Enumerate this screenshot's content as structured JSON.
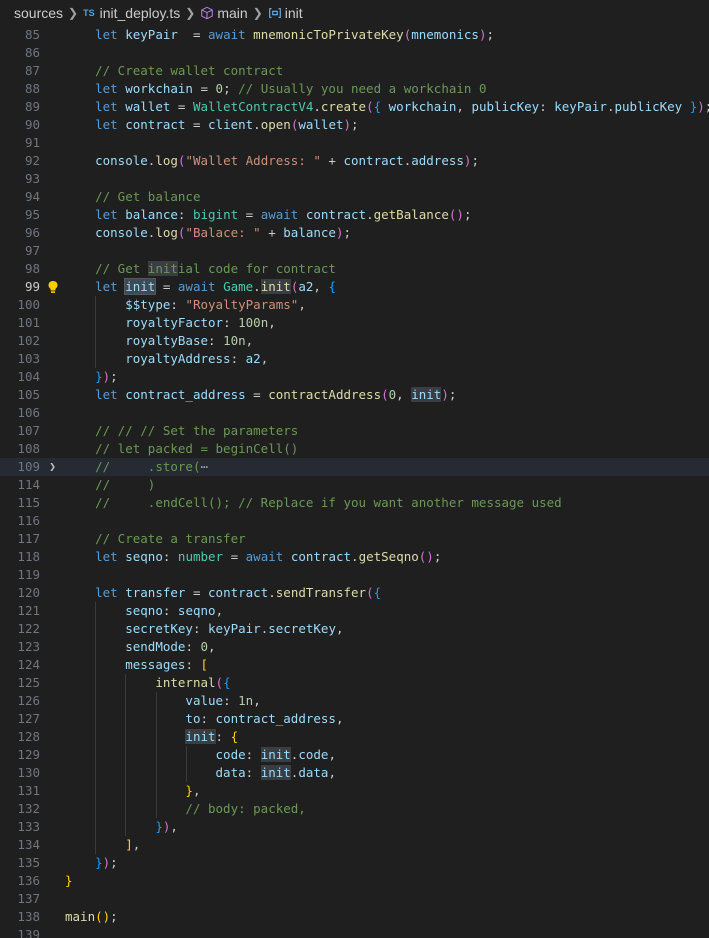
{
  "breadcrumb": {
    "folder": "sources",
    "file_badge": "TS",
    "file": "init_deploy.ts",
    "function": "main",
    "symbol": "init"
  },
  "editor": {
    "current_line": "99",
    "lines": [
      {
        "n": "85",
        "indent": 1,
        "t": [
          [
            "kw",
            "let "
          ],
          [
            "var",
            "keyPair"
          ],
          [
            "",
            "  = "
          ],
          [
            "kw",
            "await "
          ],
          [
            "fn",
            "mnemonicToPrivateKey"
          ],
          [
            "br2",
            "("
          ],
          [
            "var",
            "mnemonics"
          ],
          [
            "br2",
            ")"
          ],
          [
            "",
            ";"
          ]
        ]
      },
      {
        "n": "86",
        "indent": 0,
        "t": []
      },
      {
        "n": "87",
        "indent": 1,
        "t": [
          [
            "com",
            "// Create wallet contract"
          ]
        ]
      },
      {
        "n": "88",
        "indent": 1,
        "t": [
          [
            "kw",
            "let "
          ],
          [
            "var",
            "workchain"
          ],
          [
            "",
            " = "
          ],
          [
            "num",
            "0"
          ],
          [
            "",
            "; "
          ],
          [
            "com",
            "// Usually you need a workchain 0"
          ]
        ]
      },
      {
        "n": "89",
        "indent": 1,
        "t": [
          [
            "kw",
            "let "
          ],
          [
            "var",
            "wallet"
          ],
          [
            "",
            " = "
          ],
          [
            "cls",
            "WalletContractV4"
          ],
          [
            "",
            "."
          ],
          [
            "fn",
            "create"
          ],
          [
            "br2",
            "("
          ],
          [
            "br3",
            "{"
          ],
          [
            "",
            " "
          ],
          [
            "var",
            "workchain"
          ],
          [
            "",
            ", "
          ],
          [
            "var",
            "publicKey"
          ],
          [
            "",
            ": "
          ],
          [
            "var",
            "keyPair"
          ],
          [
            "",
            "."
          ],
          [
            "var",
            "publicKey"
          ],
          [
            "",
            " "
          ],
          [
            "br3",
            "}"
          ],
          [
            "br2",
            ")"
          ],
          [
            "",
            ";"
          ]
        ]
      },
      {
        "n": "90",
        "indent": 1,
        "t": [
          [
            "kw",
            "let "
          ],
          [
            "var",
            "contract"
          ],
          [
            "",
            " = "
          ],
          [
            "var",
            "client"
          ],
          [
            "",
            "."
          ],
          [
            "fn",
            "open"
          ],
          [
            "br2",
            "("
          ],
          [
            "var",
            "wallet"
          ],
          [
            "br2",
            ")"
          ],
          [
            "",
            ";"
          ]
        ]
      },
      {
        "n": "91",
        "indent": 0,
        "t": []
      },
      {
        "n": "92",
        "indent": 1,
        "t": [
          [
            "var",
            "console"
          ],
          [
            "",
            "."
          ],
          [
            "fn",
            "log"
          ],
          [
            "br2",
            "("
          ],
          [
            "str",
            "\"Wallet Address: \""
          ],
          [
            "",
            " + "
          ],
          [
            "var",
            "contract"
          ],
          [
            "",
            "."
          ],
          [
            "var",
            "address"
          ],
          [
            "br2",
            ")"
          ],
          [
            "",
            ";"
          ]
        ]
      },
      {
        "n": "93",
        "indent": 0,
        "t": []
      },
      {
        "n": "94",
        "indent": 1,
        "t": [
          [
            "com",
            "// Get balance"
          ]
        ]
      },
      {
        "n": "95",
        "indent": 1,
        "t": [
          [
            "kw",
            "let "
          ],
          [
            "var",
            "balance"
          ],
          [
            "",
            ": "
          ],
          [
            "cls",
            "bigint"
          ],
          [
            "",
            " = "
          ],
          [
            "kw",
            "await "
          ],
          [
            "var",
            "contract"
          ],
          [
            "",
            "."
          ],
          [
            "fn",
            "getBalance"
          ],
          [
            "br2",
            "()"
          ],
          [
            "",
            ";"
          ]
        ]
      },
      {
        "n": "96",
        "indent": 1,
        "t": [
          [
            "var",
            "console"
          ],
          [
            "",
            "."
          ],
          [
            "fn",
            "log"
          ],
          [
            "br2",
            "("
          ],
          [
            "str",
            "\"Balace: \""
          ],
          [
            "",
            " + "
          ],
          [
            "var",
            "balance"
          ],
          [
            "br2",
            ")"
          ],
          [
            "",
            ";"
          ]
        ]
      },
      {
        "n": "97",
        "indent": 0,
        "t": []
      },
      {
        "n": "98",
        "indent": 1,
        "t": [
          [
            "com",
            "// Get "
          ],
          [
            "com hl",
            "init"
          ],
          [
            "com",
            "ial code for contract"
          ]
        ]
      },
      {
        "n": "99",
        "indent": 1,
        "bulb": true,
        "t": [
          [
            "kw",
            "let "
          ],
          [
            "var hlw",
            "init"
          ],
          [
            "",
            " = "
          ],
          [
            "kw",
            "await "
          ],
          [
            "cls",
            "Game"
          ],
          [
            "",
            "."
          ],
          [
            "fn hl",
            "init"
          ],
          [
            "br2",
            "("
          ],
          [
            "var",
            "a2"
          ],
          [
            "",
            ", "
          ],
          [
            "br3",
            "{"
          ]
        ]
      },
      {
        "n": "100",
        "indent": 2,
        "t": [
          [
            "var",
            "$$type"
          ],
          [
            "",
            ": "
          ],
          [
            "str",
            "\"RoyaltyParams\""
          ],
          [
            "",
            ","
          ]
        ]
      },
      {
        "n": "101",
        "indent": 2,
        "t": [
          [
            "var",
            "royaltyFactor"
          ],
          [
            "",
            ": "
          ],
          [
            "num",
            "100n"
          ],
          [
            "",
            ","
          ]
        ]
      },
      {
        "n": "102",
        "indent": 2,
        "t": [
          [
            "var",
            "royaltyBase"
          ],
          [
            "",
            ": "
          ],
          [
            "num",
            "10n"
          ],
          [
            "",
            ","
          ]
        ]
      },
      {
        "n": "103",
        "indent": 2,
        "t": [
          [
            "var",
            "royaltyAddress"
          ],
          [
            "",
            ": "
          ],
          [
            "var",
            "a2"
          ],
          [
            "",
            ","
          ]
        ]
      },
      {
        "n": "104",
        "indent": 1,
        "t": [
          [
            "br3",
            "}"
          ],
          [
            "br2",
            ")"
          ],
          [
            "",
            ";"
          ]
        ]
      },
      {
        "n": "105",
        "indent": 1,
        "t": [
          [
            "kw",
            "let "
          ],
          [
            "var",
            "contract_address"
          ],
          [
            "",
            " = "
          ],
          [
            "fn",
            "contractAddress"
          ],
          [
            "br2",
            "("
          ],
          [
            "num",
            "0"
          ],
          [
            "",
            ", "
          ],
          [
            "var hl",
            "init"
          ],
          [
            "br2",
            ")"
          ],
          [
            "",
            ";"
          ]
        ]
      },
      {
        "n": "106",
        "indent": 0,
        "t": []
      },
      {
        "n": "107",
        "indent": 1,
        "t": [
          [
            "com",
            "// // // Set the parameters"
          ]
        ]
      },
      {
        "n": "108",
        "indent": 1,
        "t": [
          [
            "com",
            "// let packed = beginCell()"
          ]
        ]
      },
      {
        "n": "109",
        "indent": 1,
        "fold": true,
        "t": [
          [
            "com",
            "//     .store("
          ],
          [
            "fold-dots",
            "⋯"
          ]
        ]
      },
      {
        "n": "114",
        "indent": 1,
        "t": [
          [
            "com",
            "//     )"
          ]
        ]
      },
      {
        "n": "115",
        "indent": 1,
        "t": [
          [
            "com",
            "//     .endCell(); // Replace if you want another message used"
          ]
        ]
      },
      {
        "n": "116",
        "indent": 0,
        "t": []
      },
      {
        "n": "117",
        "indent": 1,
        "t": [
          [
            "com",
            "// Create a transfer"
          ]
        ]
      },
      {
        "n": "118",
        "indent": 1,
        "t": [
          [
            "kw",
            "let "
          ],
          [
            "var",
            "seqno"
          ],
          [
            "",
            ": "
          ],
          [
            "cls",
            "number"
          ],
          [
            "",
            " = "
          ],
          [
            "kw",
            "await "
          ],
          [
            "var",
            "contract"
          ],
          [
            "",
            "."
          ],
          [
            "fn",
            "getSeqno"
          ],
          [
            "br2",
            "()"
          ],
          [
            "",
            ";"
          ]
        ]
      },
      {
        "n": "119",
        "indent": 0,
        "t": []
      },
      {
        "n": "120",
        "indent": 1,
        "t": [
          [
            "kw",
            "let "
          ],
          [
            "var",
            "transfer"
          ],
          [
            "",
            " = "
          ],
          [
            "var",
            "contract"
          ],
          [
            "",
            "."
          ],
          [
            "fn",
            "sendTransfer"
          ],
          [
            "br2",
            "("
          ],
          [
            "br3",
            "{"
          ]
        ]
      },
      {
        "n": "121",
        "indent": 2,
        "t": [
          [
            "var",
            "seqno"
          ],
          [
            "",
            ": "
          ],
          [
            "var",
            "seqno"
          ],
          [
            "",
            ","
          ]
        ]
      },
      {
        "n": "122",
        "indent": 2,
        "t": [
          [
            "var",
            "secretKey"
          ],
          [
            "",
            ": "
          ],
          [
            "var",
            "keyPair"
          ],
          [
            "",
            "."
          ],
          [
            "var",
            "secretKey"
          ],
          [
            "",
            ","
          ]
        ]
      },
      {
        "n": "123",
        "indent": 2,
        "t": [
          [
            "var",
            "sendMode"
          ],
          [
            "",
            ": "
          ],
          [
            "num",
            "0"
          ],
          [
            "",
            ","
          ]
        ]
      },
      {
        "n": "124",
        "indent": 2,
        "t": [
          [
            "var",
            "messages"
          ],
          [
            "",
            ": "
          ],
          [
            "br1",
            "["
          ]
        ]
      },
      {
        "n": "125",
        "indent": 3,
        "t": [
          [
            "fn",
            "internal"
          ],
          [
            "br2",
            "("
          ],
          [
            "br3",
            "{"
          ]
        ]
      },
      {
        "n": "126",
        "indent": 4,
        "t": [
          [
            "var",
            "value"
          ],
          [
            "",
            ": "
          ],
          [
            "num",
            "1n"
          ],
          [
            "",
            ","
          ]
        ]
      },
      {
        "n": "127",
        "indent": 4,
        "t": [
          [
            "var",
            "to"
          ],
          [
            "",
            ": "
          ],
          [
            "var",
            "contract_address"
          ],
          [
            "",
            ","
          ]
        ]
      },
      {
        "n": "128",
        "indent": 4,
        "t": [
          [
            "var hl",
            "init"
          ],
          [
            "",
            ": "
          ],
          [
            "br1",
            "{"
          ]
        ]
      },
      {
        "n": "129",
        "indent": 5,
        "t": [
          [
            "var",
            "code"
          ],
          [
            "",
            ": "
          ],
          [
            "var hl",
            "init"
          ],
          [
            "",
            "."
          ],
          [
            "var",
            "code"
          ],
          [
            "",
            ","
          ]
        ]
      },
      {
        "n": "130",
        "indent": 5,
        "t": [
          [
            "var",
            "data"
          ],
          [
            "",
            ": "
          ],
          [
            "var hl",
            "init"
          ],
          [
            "",
            "."
          ],
          [
            "var",
            "data"
          ],
          [
            "",
            ","
          ]
        ]
      },
      {
        "n": "131",
        "indent": 4,
        "t": [
          [
            "br1",
            "}"
          ],
          [
            "",
            ","
          ]
        ]
      },
      {
        "n": "132",
        "indent": 4,
        "t": [
          [
            "com",
            "// body: packed,"
          ]
        ]
      },
      {
        "n": "133",
        "indent": 3,
        "t": [
          [
            "br3",
            "}"
          ],
          [
            "br2",
            ")"
          ],
          [
            "",
            ","
          ]
        ]
      },
      {
        "n": "134",
        "indent": 2,
        "t": [
          [
            "br1",
            "]"
          ],
          [
            "",
            ","
          ]
        ]
      },
      {
        "n": "135",
        "indent": 1,
        "t": [
          [
            "br3",
            "}"
          ],
          [
            "br2",
            ")"
          ],
          [
            "",
            ";"
          ]
        ]
      },
      {
        "n": "136",
        "indent": 0,
        "t": [
          [
            "br1",
            "}"
          ]
        ]
      },
      {
        "n": "137",
        "indent": 0,
        "t": []
      },
      {
        "n": "138",
        "indent": 0,
        "t": [
          [
            "fn",
            "main"
          ],
          [
            "br1",
            "()"
          ],
          [
            "",
            ";"
          ]
        ]
      },
      {
        "n": "139",
        "indent": 0,
        "t": []
      }
    ]
  }
}
